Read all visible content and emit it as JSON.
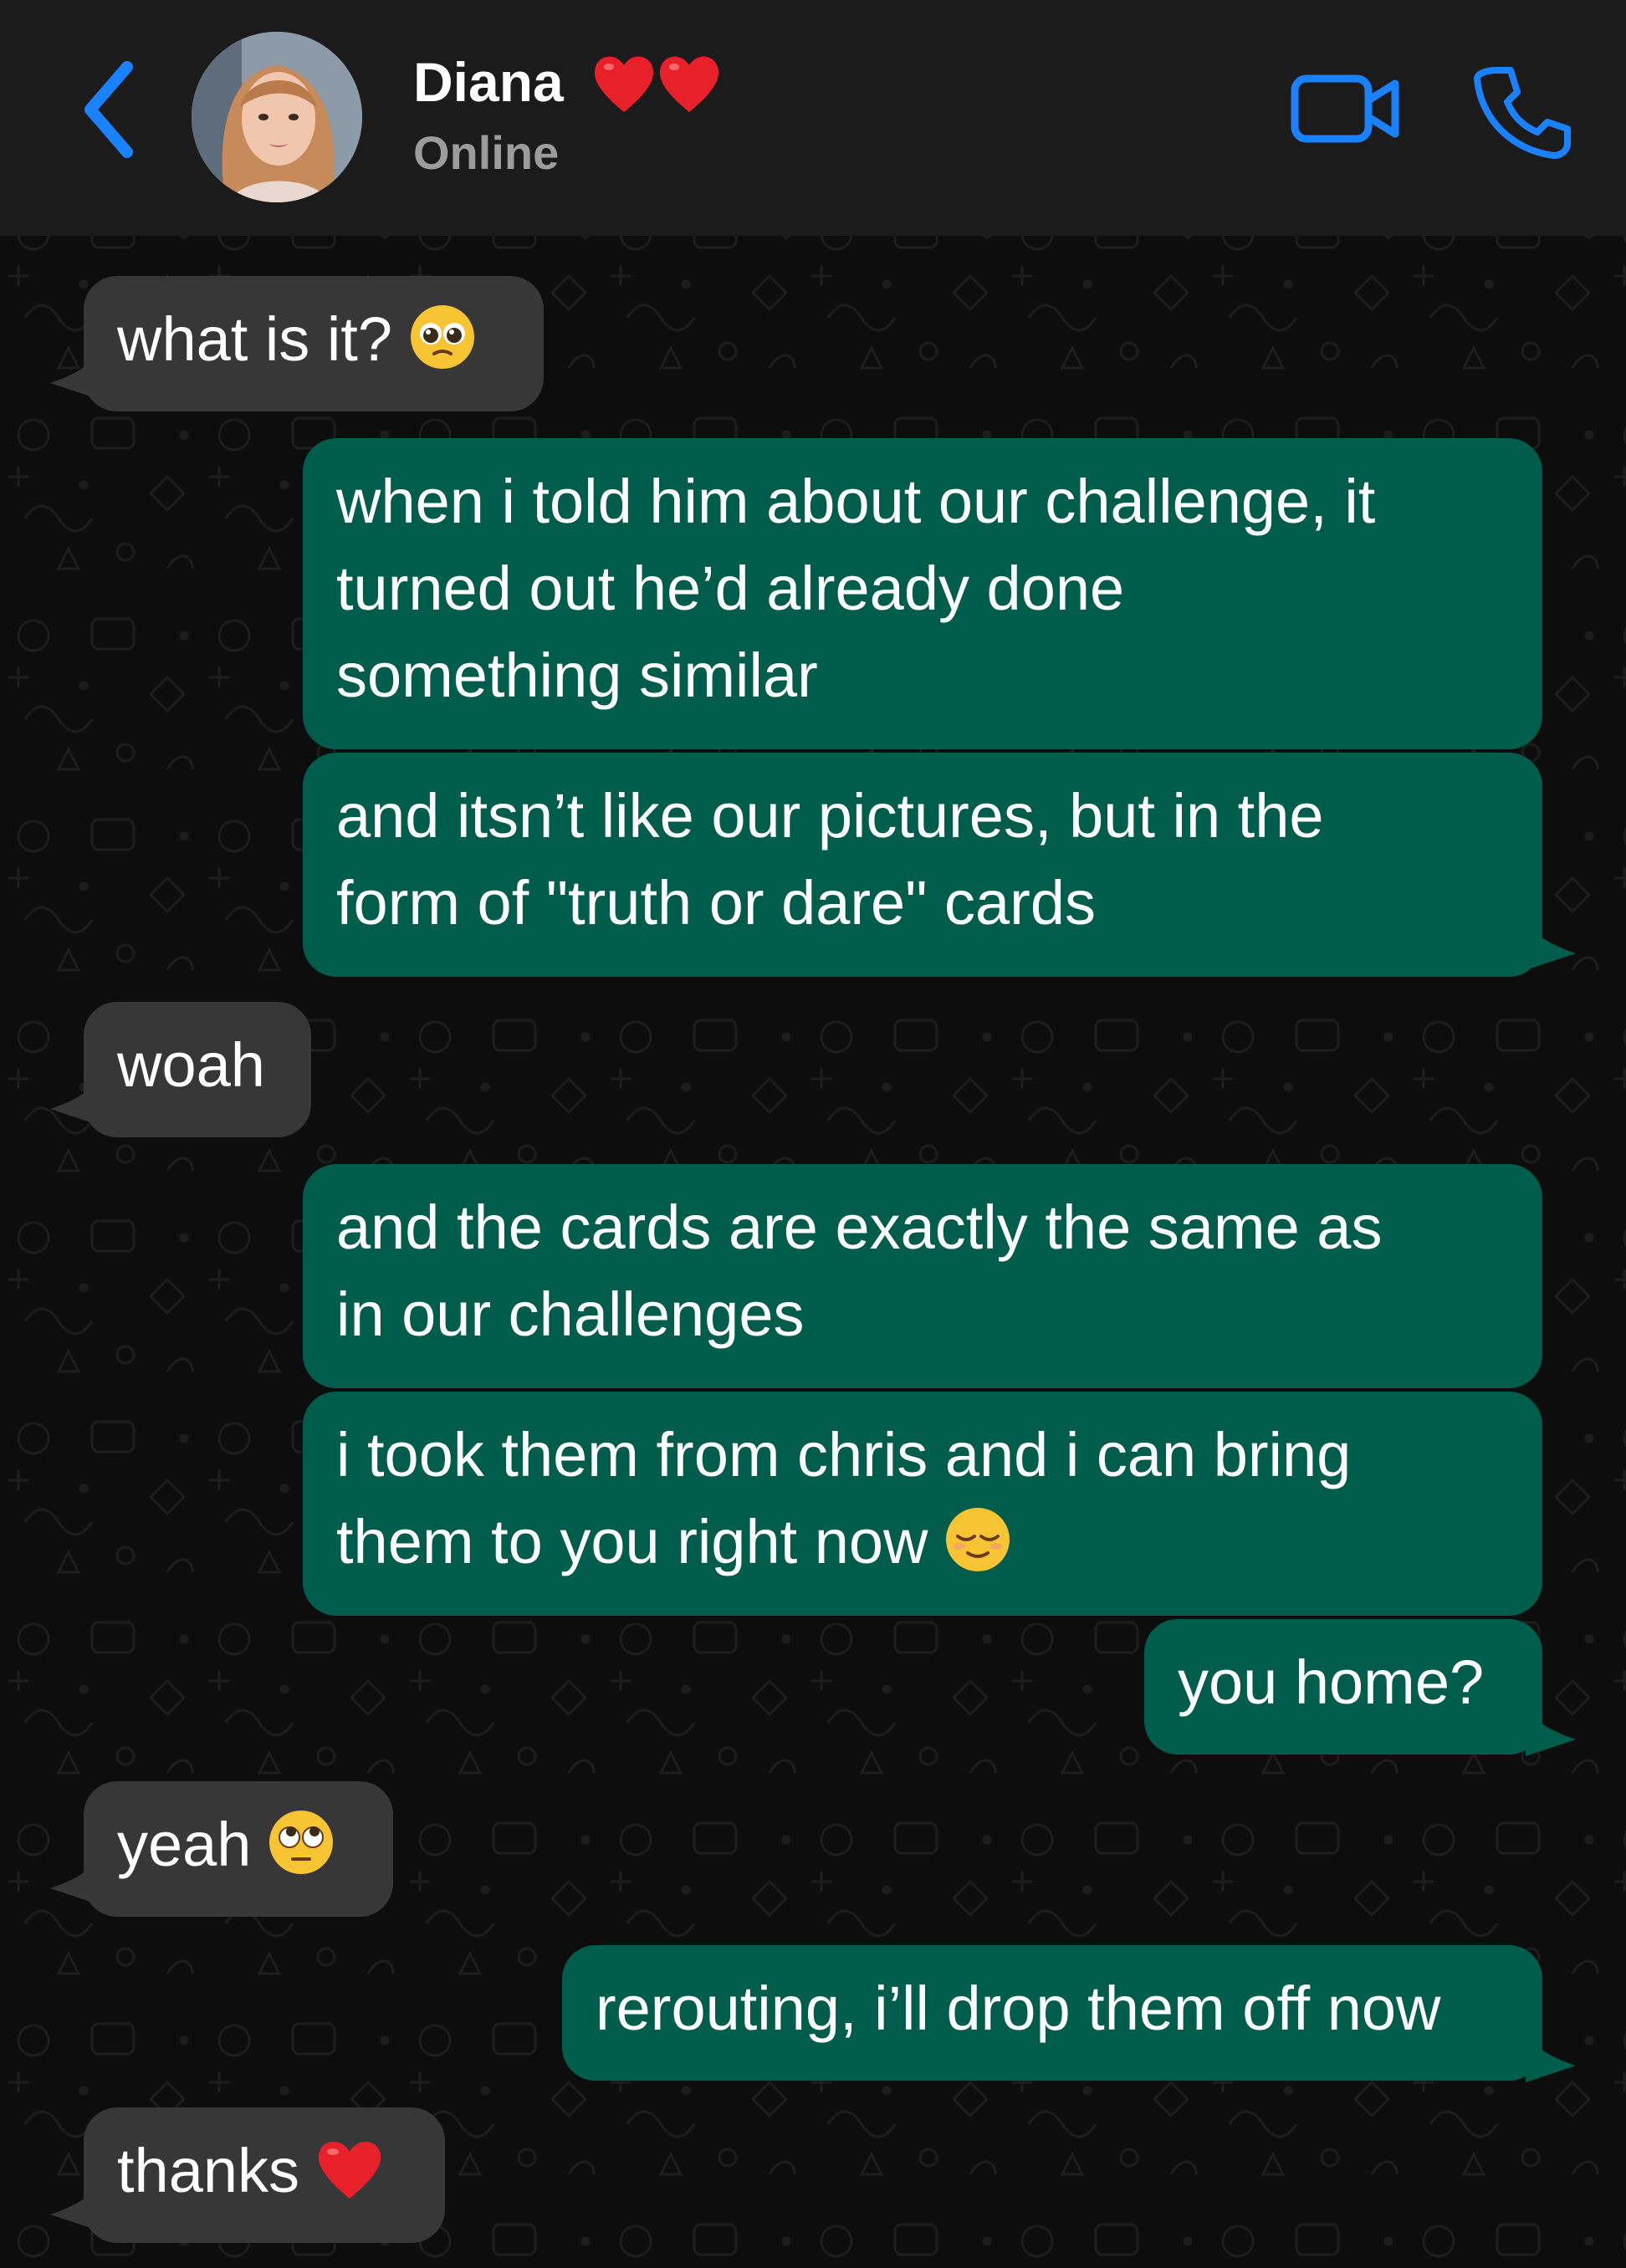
{
  "header": {
    "contact_name": "Diana",
    "name_suffix_icons": [
      "red-heart-icon",
      "red-heart-icon"
    ],
    "status": "Online",
    "back_icon": "chevron-left-icon",
    "video_icon": "video-camera-icon",
    "call_icon": "phone-icon"
  },
  "colors": {
    "header_bg": "#1b1b1b",
    "chat_bg": "#0d0d0d",
    "incoming_bubble": "#373737",
    "outgoing_bubble": "#005c4b",
    "accent_blue": "#1a82ff",
    "status_gray": "#9c9c9c"
  },
  "messages": [
    {
      "direction": "incoming",
      "text": "what is it?",
      "emoji": "pleading-face-emoji"
    },
    {
      "direction": "outgoing",
      "text": "when i told him about our challenge, it\nturned out he’d already done\nsomething similar"
    },
    {
      "direction": "outgoing",
      "text": "and itsn’t like our pictures, but in the\nform of \"truth or dare\" cards"
    },
    {
      "direction": "incoming",
      "text": "woah"
    },
    {
      "direction": "outgoing",
      "text": "and the cards are exactly the same as\nin our challenges"
    },
    {
      "direction": "outgoing",
      "text": "i took them from chris and i can bring\nthem to you right now",
      "emoji": "relieved-face-emoji"
    },
    {
      "direction": "outgoing",
      "text": "you home?"
    },
    {
      "direction": "incoming",
      "text": "yeah",
      "emoji": "rolling-eyes-emoji"
    },
    {
      "direction": "outgoing",
      "text": "rerouting, i’ll drop them off now"
    },
    {
      "direction": "incoming",
      "text": "thanks",
      "emoji": "red-heart-emoji"
    }
  ]
}
